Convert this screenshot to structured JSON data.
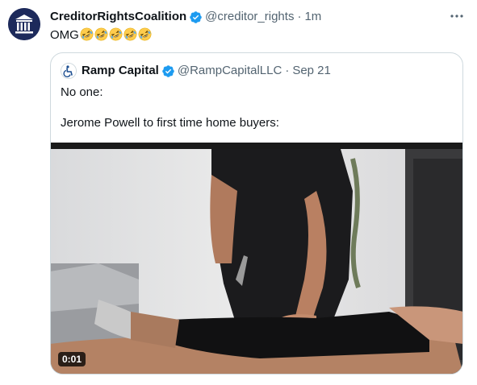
{
  "tweet": {
    "author_name": "CreditorRightsCoalition",
    "handle": "@creditor_rights",
    "separator": "·",
    "time": "1m",
    "text": "OMG",
    "emoji_count": 5,
    "emoji_icon": "rolling-on-floor-laughing"
  },
  "quote": {
    "author_name": "Ramp Capital",
    "handle": "@RampCapitalLLC",
    "separator": "·",
    "date": "Sep 21",
    "line1": "No one:",
    "line2": "Jerome Powell to first time home buyers:",
    "video_duration": "0:01"
  },
  "colors": {
    "verified": "#1d9bf0",
    "secondary_text": "#536471",
    "border": "#cfd9de"
  }
}
